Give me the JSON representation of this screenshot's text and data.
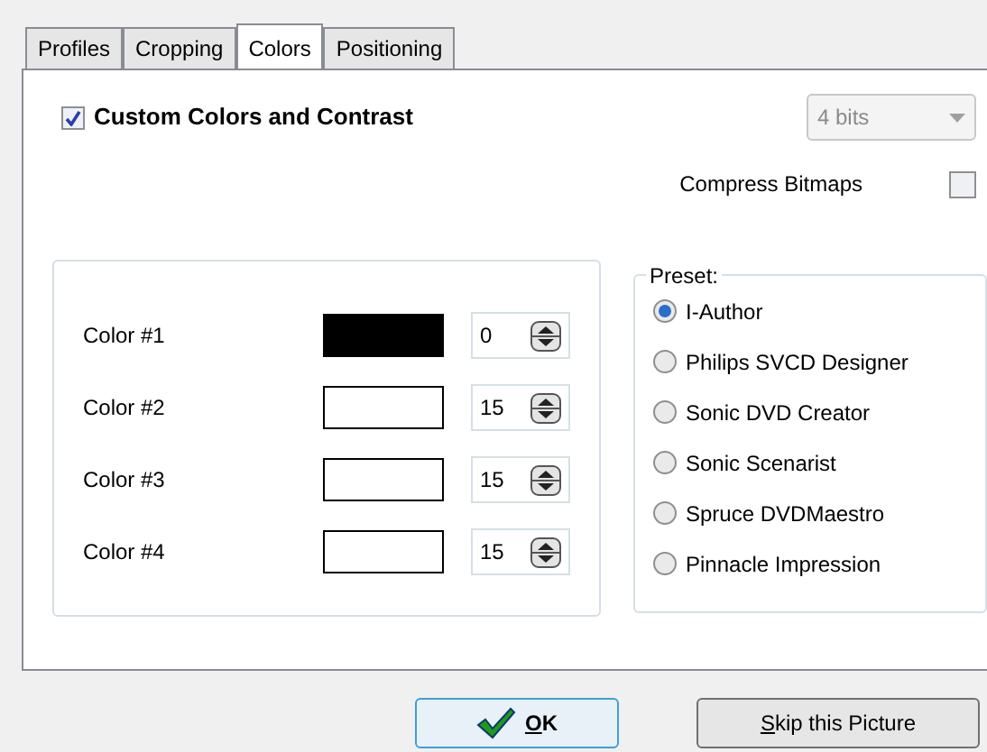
{
  "tabs": [
    {
      "label": "Profiles",
      "selected": false
    },
    {
      "label": "Cropping",
      "selected": false
    },
    {
      "label": "Colors",
      "selected": true
    },
    {
      "label": "Positioning",
      "selected": false
    }
  ],
  "custom_colors": {
    "label": "Custom Colors and Contrast",
    "checked": true
  },
  "bits_dropdown": {
    "value": "4 bits",
    "disabled": true
  },
  "compress_bitmaps": {
    "label": "Compress Bitmaps",
    "checked": false
  },
  "colors": [
    {
      "label": "Color #1",
      "color": "#000000",
      "value": "0"
    },
    {
      "label": "Color #2",
      "color": "#ffffff",
      "value": "15"
    },
    {
      "label": "Color #3",
      "color": "#ffffff",
      "value": "15"
    },
    {
      "label": "Color #4",
      "color": "#ffffff",
      "value": "15"
    }
  ],
  "preset": {
    "legend": "Preset:",
    "options": [
      {
        "label": "I-Author",
        "selected": true
      },
      {
        "label": "Philips SVCD Designer",
        "selected": false
      },
      {
        "label": "Sonic DVD Creator",
        "selected": false
      },
      {
        "label": "Sonic Scenarist",
        "selected": false
      },
      {
        "label": "Spruce DVDMaestro",
        "selected": false
      },
      {
        "label": "Pinnacle Impression",
        "selected": false
      }
    ]
  },
  "buttons": [
    {
      "label": "OK",
      "kind": "ok"
    },
    {
      "label": "Skip this Picture",
      "kind": "plain"
    }
  ]
}
